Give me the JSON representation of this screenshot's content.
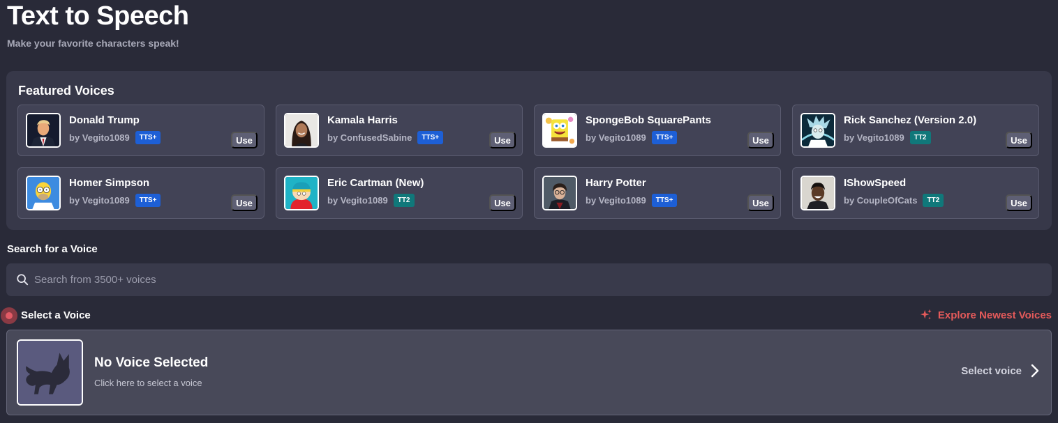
{
  "header": {
    "title": "Text to Speech",
    "subtitle": "Make your favorite characters speak!"
  },
  "featured": {
    "title": "Featured Voices",
    "use_label": "Use",
    "voices": [
      {
        "name": "Donald Trump",
        "author": "by Vegito1089",
        "badge": "TTS+",
        "avatar_icon": "trump-avatar"
      },
      {
        "name": "Kamala Harris",
        "author": "by ConfusedSabine",
        "badge": "TTS+",
        "avatar_icon": "harris-avatar"
      },
      {
        "name": "SpongeBob SquarePants",
        "author": "by Vegito1089",
        "badge": "TTS+",
        "avatar_icon": "spongebob-avatar"
      },
      {
        "name": "Rick Sanchez (Version 2.0)",
        "author": "by Vegito1089",
        "badge": "TT2",
        "avatar_icon": "rick-avatar"
      },
      {
        "name": "Homer Simpson",
        "author": "by Vegito1089",
        "badge": "TTS+",
        "avatar_icon": "homer-avatar"
      },
      {
        "name": "Eric Cartman (New)",
        "author": "by Vegito1089",
        "badge": "TT2",
        "avatar_icon": "cartman-avatar"
      },
      {
        "name": "Harry Potter",
        "author": "by Vegito1089",
        "badge": "TTS+",
        "avatar_icon": "harry-avatar"
      },
      {
        "name": "IShowSpeed",
        "author": "by CoupleOfCats",
        "badge": "TT2",
        "avatar_icon": "ishowspeed-avatar"
      }
    ]
  },
  "search": {
    "label": "Search for a Voice",
    "placeholder": "Search from 3500+ voices"
  },
  "select": {
    "label": "Select a Voice",
    "explore_label": "Explore Newest Voices",
    "no_voice_title": "No Voice Selected",
    "no_voice_subtitle": "Click here to select a voice",
    "action_label": "Select voice"
  },
  "colors": {
    "background": "#292a38",
    "panel": "#373849",
    "card": "#424356",
    "badge_tts_plus": "#1d5fd6",
    "badge_tt2": "#10787a",
    "accent_red": "#e55a5a"
  }
}
